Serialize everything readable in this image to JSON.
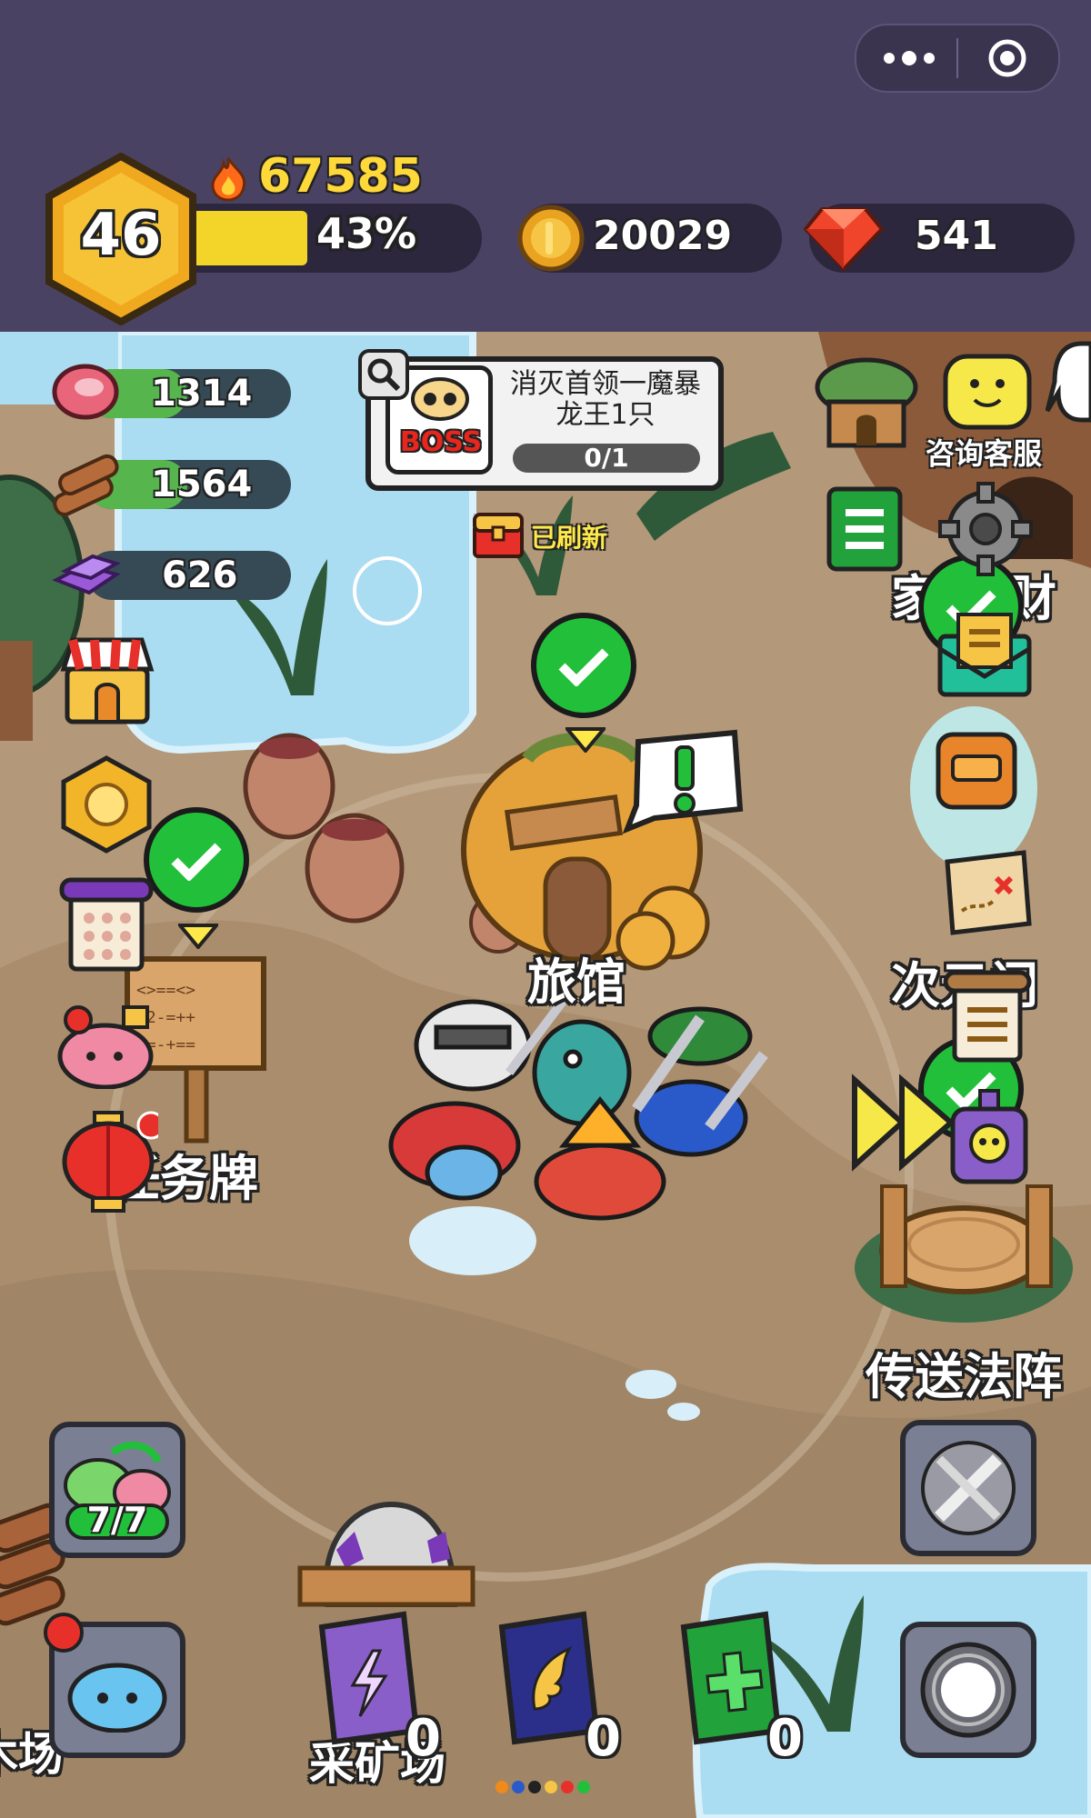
{
  "topbar": {
    "level": "46",
    "power": "67585",
    "exp_percent_label": "43%",
    "exp_progress": 0.43,
    "gold": "20029",
    "gems": "541"
  },
  "resources": {
    "meat": "1314",
    "wood": "1564",
    "ore": "626"
  },
  "quest": {
    "badge": "BOSS",
    "title": "消灭首领一魔暴龙王1只",
    "progress": "0/1"
  },
  "chest_notice": "已刷新",
  "buildings": {
    "inn": "旅馆",
    "task_board": "任务牌",
    "teleport": "传送法阵",
    "dimension_gate": "次元门",
    "customer_service": "咨询客服",
    "home_partial": "家",
    "treasure_partial": "财",
    "quarry_partial": "采矿场",
    "lumber_partial": "木场"
  },
  "slime_counter": "7/7",
  "books": [
    {
      "name": "lightning-book",
      "count": "0",
      "color": "#8a5ec8"
    },
    {
      "name": "wing-book",
      "count": "0",
      "color": "#2c2f8a"
    },
    {
      "name": "heal-book",
      "count": "0",
      "color": "#22a23a"
    }
  ],
  "colors": {
    "topbar_bg": "#4a4262",
    "exp_fill": "#f3d52a",
    "check_green": "#22c03a",
    "ground": "#b3987a",
    "water": "#aadcf2"
  }
}
